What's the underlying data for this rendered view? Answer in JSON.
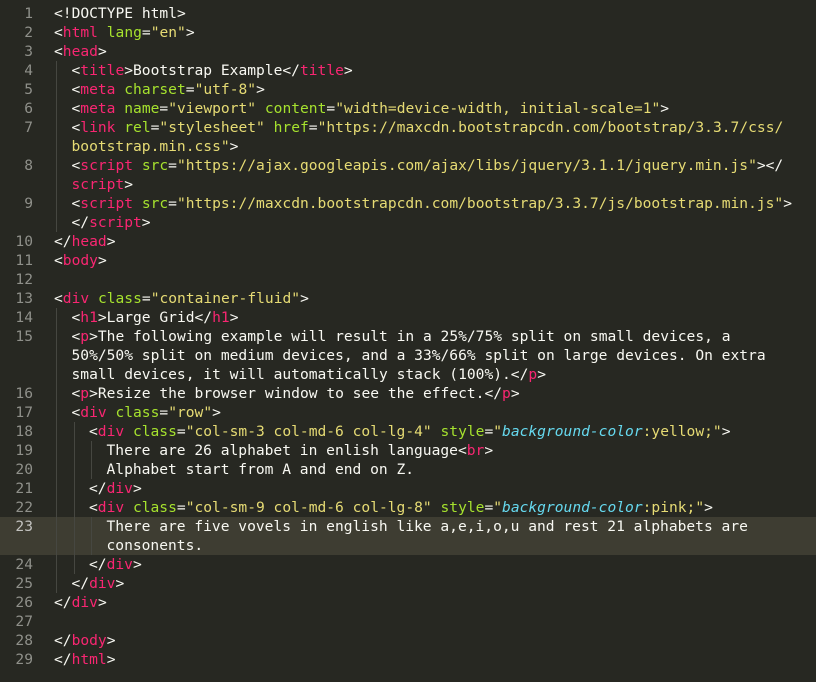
{
  "editor": {
    "theme_colors": {
      "background": "#272822",
      "tag": "#f92672",
      "attribute": "#a6e22e",
      "string": "#e6db74",
      "text": "#f8f8f2",
      "css_property": "#66d9ef",
      "line_number": "#8f908a",
      "active_line": "#3e3d32"
    },
    "active_line": 23,
    "rows": [
      {
        "ln": "1",
        "indent": 0,
        "tokens": [
          [
            "p",
            "<!DOCTYPE html>"
          ]
        ]
      },
      {
        "ln": "2",
        "indent": 0,
        "tokens": [
          [
            "p",
            "<"
          ],
          [
            "t",
            "html"
          ],
          [
            "p",
            " "
          ],
          [
            "a",
            "lang"
          ],
          [
            "p",
            "="
          ],
          [
            "s",
            "\"en\""
          ],
          [
            "p",
            ">"
          ]
        ]
      },
      {
        "ln": "3",
        "indent": 0,
        "tokens": [
          [
            "p",
            "<"
          ],
          [
            "t",
            "head"
          ],
          [
            "p",
            ">"
          ]
        ]
      },
      {
        "ln": "4",
        "indent": 1,
        "tokens": [
          [
            "p",
            "<"
          ],
          [
            "t",
            "title"
          ],
          [
            "p",
            ">Bootstrap Example</"
          ],
          [
            "t",
            "title"
          ],
          [
            "p",
            ">"
          ]
        ]
      },
      {
        "ln": "5",
        "indent": 1,
        "tokens": [
          [
            "p",
            "<"
          ],
          [
            "t",
            "meta"
          ],
          [
            "p",
            " "
          ],
          [
            "a",
            "charset"
          ],
          [
            "p",
            "="
          ],
          [
            "s",
            "\"utf-8\""
          ],
          [
            "p",
            ">"
          ]
        ]
      },
      {
        "ln": "6",
        "indent": 1,
        "tokens": [
          [
            "p",
            "<"
          ],
          [
            "t",
            "meta"
          ],
          [
            "p",
            " "
          ],
          [
            "a",
            "name"
          ],
          [
            "p",
            "="
          ],
          [
            "s",
            "\"viewport\""
          ],
          [
            "p",
            " "
          ],
          [
            "a",
            "content"
          ],
          [
            "p",
            "="
          ],
          [
            "s",
            "\"width=device-width, initial-scale=1\""
          ],
          [
            "p",
            ">"
          ]
        ]
      },
      {
        "ln": "7",
        "indent": 1,
        "tokens": [
          [
            "p",
            "<"
          ],
          [
            "t",
            "link"
          ],
          [
            "p",
            " "
          ],
          [
            "a",
            "rel"
          ],
          [
            "p",
            "="
          ],
          [
            "s",
            "\"stylesheet\""
          ],
          [
            "p",
            " "
          ],
          [
            "a",
            "href"
          ],
          [
            "p",
            "="
          ],
          [
            "s",
            "\"https://maxcdn.bootstrapcdn.com/bootstrap/3.3.7/css/"
          ]
        ]
      },
      {
        "ln": "",
        "indent": 1,
        "tokens": [
          [
            "s",
            "bootstrap.min.css\""
          ],
          [
            "p",
            ">"
          ]
        ]
      },
      {
        "ln": "8",
        "indent": 1,
        "tokens": [
          [
            "p",
            "<"
          ],
          [
            "t",
            "script"
          ],
          [
            "p",
            " "
          ],
          [
            "a",
            "src"
          ],
          [
            "p",
            "="
          ],
          [
            "s",
            "\"https://ajax.googleapis.com/ajax/libs/jquery/3.1.1/jquery.min.js\""
          ],
          [
            "p",
            "></"
          ]
        ]
      },
      {
        "ln": "",
        "indent": 1,
        "tokens": [
          [
            "t",
            "script"
          ],
          [
            "p",
            ">"
          ]
        ]
      },
      {
        "ln": "9",
        "indent": 1,
        "tokens": [
          [
            "p",
            "<"
          ],
          [
            "t",
            "script"
          ],
          [
            "p",
            " "
          ],
          [
            "a",
            "src"
          ],
          [
            "p",
            "="
          ],
          [
            "s",
            "\"https://maxcdn.bootstrapcdn.com/bootstrap/3.3.7/js/bootstrap.min.js\""
          ],
          [
            "p",
            ">"
          ]
        ]
      },
      {
        "ln": "",
        "indent": 1,
        "tokens": [
          [
            "p",
            "</"
          ],
          [
            "t",
            "script"
          ],
          [
            "p",
            ">"
          ]
        ]
      },
      {
        "ln": "10",
        "indent": 0,
        "tokens": [
          [
            "p",
            "</"
          ],
          [
            "t",
            "head"
          ],
          [
            "p",
            ">"
          ]
        ]
      },
      {
        "ln": "11",
        "indent": 0,
        "tokens": [
          [
            "p",
            "<"
          ],
          [
            "t",
            "body"
          ],
          [
            "p",
            ">"
          ]
        ]
      },
      {
        "ln": "12",
        "indent": 0,
        "tokens": []
      },
      {
        "ln": "13",
        "indent": 0,
        "tokens": [
          [
            "p",
            "<"
          ],
          [
            "t",
            "div"
          ],
          [
            "p",
            " "
          ],
          [
            "a",
            "class"
          ],
          [
            "p",
            "="
          ],
          [
            "s",
            "\"container-fluid\""
          ],
          [
            "p",
            ">"
          ]
        ]
      },
      {
        "ln": "14",
        "indent": 1,
        "tokens": [
          [
            "p",
            "<"
          ],
          [
            "t",
            "h1"
          ],
          [
            "p",
            ">Large Grid</"
          ],
          [
            "t",
            "h1"
          ],
          [
            "p",
            ">"
          ]
        ]
      },
      {
        "ln": "15",
        "indent": 1,
        "tokens": [
          [
            "p",
            "<"
          ],
          [
            "t",
            "p"
          ],
          [
            "p",
            ">The following example will result in a 25%/75% split on small devices, a"
          ]
        ]
      },
      {
        "ln": "",
        "indent": 1,
        "tokens": [
          [
            "p",
            "50%/50% split on medium devices, and a 33%/66% split on large devices. On extra"
          ]
        ]
      },
      {
        "ln": "",
        "indent": 1,
        "tokens": [
          [
            "p",
            "small devices, it will automatically stack (100%).</"
          ],
          [
            "t",
            "p"
          ],
          [
            "p",
            ">"
          ]
        ]
      },
      {
        "ln": "16",
        "indent": 1,
        "tokens": [
          [
            "p",
            "<"
          ],
          [
            "t",
            "p"
          ],
          [
            "p",
            ">Resize the browser window to see the effect.</"
          ],
          [
            "t",
            "p"
          ],
          [
            "p",
            ">"
          ]
        ]
      },
      {
        "ln": "17",
        "indent": 1,
        "tokens": [
          [
            "p",
            "<"
          ],
          [
            "t",
            "div"
          ],
          [
            "p",
            " "
          ],
          [
            "a",
            "class"
          ],
          [
            "p",
            "="
          ],
          [
            "s",
            "\"row\""
          ],
          [
            "p",
            ">"
          ]
        ]
      },
      {
        "ln": "18",
        "indent": 2,
        "tokens": [
          [
            "p",
            "<"
          ],
          [
            "t",
            "div"
          ],
          [
            "p",
            " "
          ],
          [
            "a",
            "class"
          ],
          [
            "p",
            "="
          ],
          [
            "s",
            "\"col-sm-3 col-md-6 col-lg-4\""
          ],
          [
            "p",
            " "
          ],
          [
            "a",
            "style"
          ],
          [
            "p",
            "="
          ],
          [
            "s",
            "\""
          ],
          [
            "k",
            "background-color"
          ],
          [
            "s",
            ":yellow;\""
          ],
          [
            "p",
            ">"
          ]
        ]
      },
      {
        "ln": "19",
        "indent": 3,
        "tokens": [
          [
            "p",
            "There are 26 alphabet in enlish language<"
          ],
          [
            "t",
            "br"
          ],
          [
            "p",
            ">"
          ]
        ]
      },
      {
        "ln": "20",
        "indent": 3,
        "tokens": [
          [
            "p",
            "Alphabet start from A and end on Z."
          ]
        ]
      },
      {
        "ln": "21",
        "indent": 2,
        "tokens": [
          [
            "p",
            "</"
          ],
          [
            "t",
            "div"
          ],
          [
            "p",
            ">"
          ]
        ]
      },
      {
        "ln": "22",
        "indent": 2,
        "tokens": [
          [
            "p",
            "<"
          ],
          [
            "t",
            "div"
          ],
          [
            "p",
            " "
          ],
          [
            "a",
            "class"
          ],
          [
            "p",
            "="
          ],
          [
            "s",
            "\"col-sm-9 col-md-6 col-lg-8\""
          ],
          [
            "p",
            " "
          ],
          [
            "a",
            "style"
          ],
          [
            "p",
            "="
          ],
          [
            "s",
            "\""
          ],
          [
            "k",
            "background-color"
          ],
          [
            "s",
            ":pink;\""
          ],
          [
            "p",
            ">"
          ]
        ]
      },
      {
        "ln": "23",
        "indent": 3,
        "active": true,
        "tokens": [
          [
            "p",
            "There are five vovels in english like a,e,i,o,u and rest 21 alphabets are"
          ]
        ]
      },
      {
        "ln": "",
        "indent": 3,
        "active": true,
        "tokens": [
          [
            "p",
            "consonents."
          ]
        ]
      },
      {
        "ln": "24",
        "indent": 2,
        "tokens": [
          [
            "p",
            "</"
          ],
          [
            "t",
            "div"
          ],
          [
            "p",
            ">"
          ]
        ]
      },
      {
        "ln": "25",
        "indent": 1,
        "tokens": [
          [
            "p",
            "</"
          ],
          [
            "t",
            "div"
          ],
          [
            "p",
            ">"
          ]
        ]
      },
      {
        "ln": "26",
        "indent": 0,
        "tokens": [
          [
            "p",
            "</"
          ],
          [
            "t",
            "div"
          ],
          [
            "p",
            ">"
          ]
        ]
      },
      {
        "ln": "27",
        "indent": 0,
        "tokens": []
      },
      {
        "ln": "28",
        "indent": 0,
        "tokens": [
          [
            "p",
            "</"
          ],
          [
            "t",
            "body"
          ],
          [
            "p",
            ">"
          ]
        ]
      },
      {
        "ln": "29",
        "indent": 0,
        "tokens": [
          [
            "p",
            "</"
          ],
          [
            "t",
            "html"
          ],
          [
            "p",
            ">"
          ]
        ]
      }
    ]
  }
}
